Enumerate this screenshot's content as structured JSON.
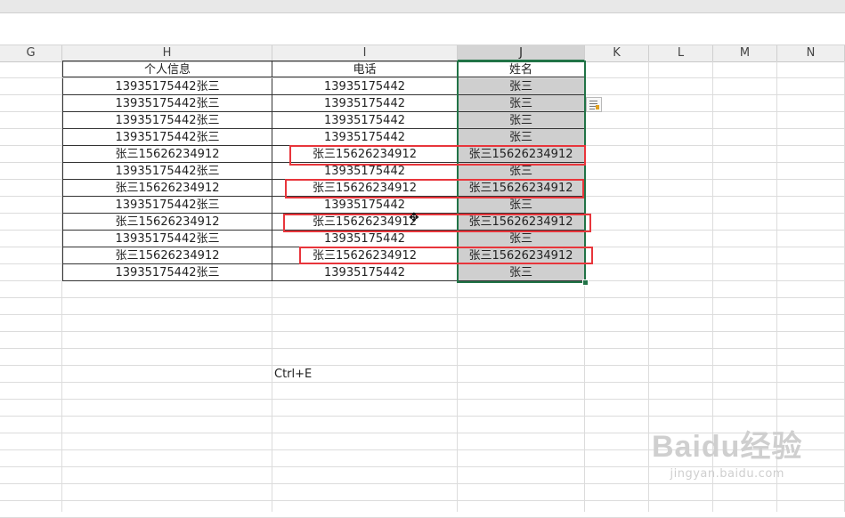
{
  "columns": [
    "G",
    "H",
    "I",
    "J",
    "K",
    "L",
    "M",
    "N"
  ],
  "table": {
    "headers": [
      "个人信息",
      "电话",
      "姓名"
    ],
    "rows": [
      [
        "13935175442张三",
        "13935175442",
        "张三"
      ],
      [
        "13935175442张三",
        "13935175442",
        "张三"
      ],
      [
        "13935175442张三",
        "13935175442",
        "张三"
      ],
      [
        "13935175442张三",
        "13935175442",
        "张三"
      ],
      [
        "张三15626234912",
        "张三15626234912",
        "张三15626234912"
      ],
      [
        "13935175442张三",
        "13935175442",
        "张三"
      ],
      [
        "张三15626234912",
        "张三15626234912",
        "张三15626234912"
      ],
      [
        "13935175442张三",
        "13935175442",
        "张三"
      ],
      [
        "张三15626234912",
        "张三15626234912",
        "张三15626234912"
      ],
      [
        "13935175442张三",
        "13935175442",
        "张三"
      ],
      [
        "张三15626234912",
        "张三15626234912",
        "张三15626234912"
      ],
      [
        "13935175442张三",
        "13935175442",
        "张三"
      ]
    ]
  },
  "note": "Ctrl+E",
  "watermark": {
    "main": "Baidu经验",
    "url": "jingyan.baidu.com"
  },
  "colors": {
    "selection": "#217346",
    "highlight_box": "#e8353b",
    "filled_cell": "#cfcfcf"
  },
  "icons": {
    "flash_fill_options": "flash-fill-options-icon",
    "cursor": "move-cursor-icon"
  }
}
